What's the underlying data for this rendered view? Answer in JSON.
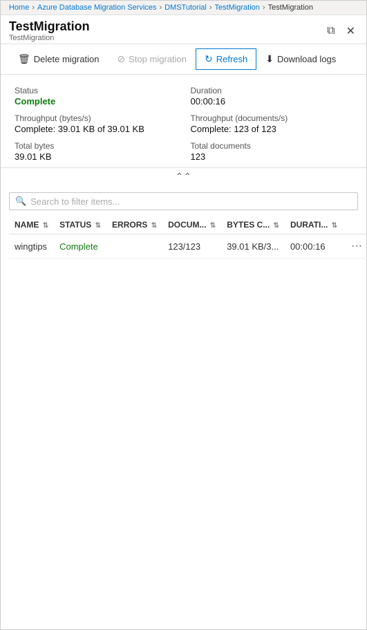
{
  "breadcrumb": {
    "items": [
      {
        "label": "Home",
        "link": true
      },
      {
        "label": "Azure Database Migration Services",
        "link": true
      },
      {
        "label": "DMSTutorial",
        "link": true
      },
      {
        "label": "TestMigration",
        "link": true
      },
      {
        "label": "TestMigration",
        "link": false
      }
    ]
  },
  "title": {
    "main": "TestMigration",
    "sub": "TestMigration"
  },
  "toolbar": {
    "delete_label": "Delete migration",
    "stop_label": "Stop migration",
    "refresh_label": "Refresh",
    "download_label": "Download logs"
  },
  "stats": {
    "status_label": "Status",
    "status_value": "Complete",
    "duration_label": "Duration",
    "duration_value": "00:00:16",
    "throughput_bytes_label": "Throughput (bytes/s)",
    "throughput_bytes_value": "Complete: 39.01 KB of 39.01 KB",
    "throughput_docs_label": "Throughput (documents/s)",
    "throughput_docs_value": "Complete: 123 of 123",
    "total_bytes_label": "Total bytes",
    "total_bytes_value": "39.01 KB",
    "total_docs_label": "Total documents",
    "total_docs_value": "123"
  },
  "search": {
    "placeholder": "Search to filter items..."
  },
  "table": {
    "columns": [
      {
        "label": "NAME",
        "key": "name"
      },
      {
        "label": "STATUS",
        "key": "status"
      },
      {
        "label": "ERRORS",
        "key": "errors"
      },
      {
        "label": "DOCUM...",
        "key": "documents"
      },
      {
        "label": "BYTES C...",
        "key": "bytes"
      },
      {
        "label": "DURATI...",
        "key": "duration"
      }
    ],
    "rows": [
      {
        "name": "wingtips",
        "status": "Complete",
        "errors": "",
        "documents": "123/123",
        "bytes": "39.01 KB/3...",
        "duration": "00:00:16"
      }
    ]
  }
}
